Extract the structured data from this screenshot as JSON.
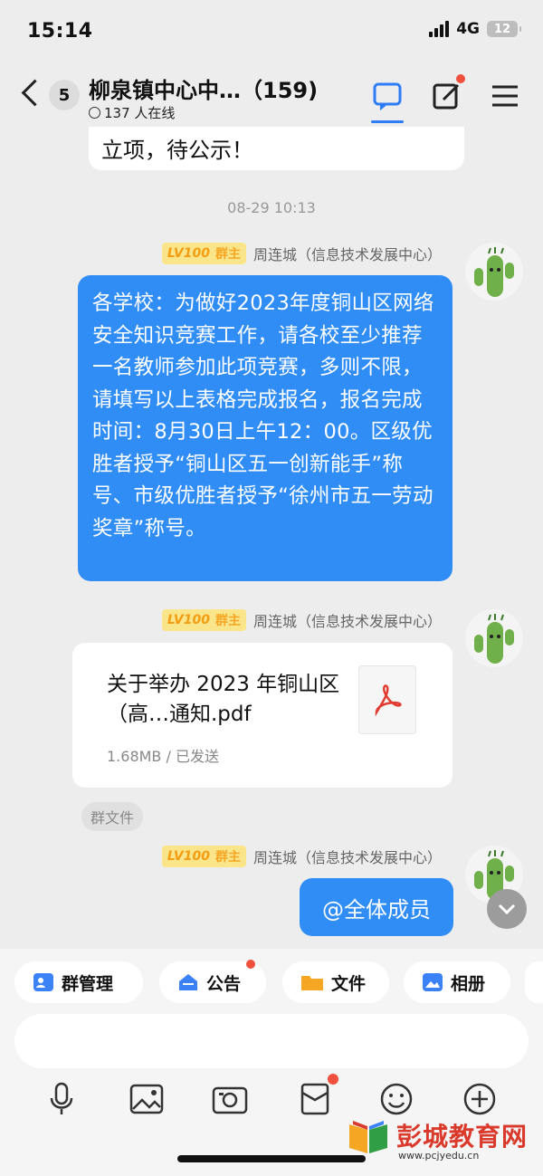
{
  "status_bar": {
    "time": "15:14",
    "network": "4G",
    "battery": "12"
  },
  "header": {
    "unread_count": "5",
    "title": "柳泉镇中心中…（159)",
    "online": "137 人在线"
  },
  "messages": {
    "previous_text": "立项，待公示！",
    "timestamp": "08-29 10:13",
    "sender": {
      "level": "LV100",
      "role": "群主",
      "name": "周连城（信息技术发展中心）"
    },
    "text_message": "各学校：为做好2023年度铜山区网络安全知识竞赛工作，请各校至少推荐一名教师参加此项竞赛，多则不限，请填写以上表格完成报名，报名完成时间：8月30日上午12：00。区级优胜者授予“铜山区五一创新能手”称号、市级优胜者授予“徐州市五一劳动奖章”称号。",
    "file": {
      "name": "关于举办 2023 年铜山区（高…通知.pdf",
      "meta": "1.68MB / 已发送",
      "tag": "群文件"
    },
    "at_all": "@全体成员"
  },
  "quick_actions": [
    {
      "label": "群管理",
      "icon": "group-manage-icon",
      "badge": false
    },
    {
      "label": "公告",
      "icon": "announcement-icon",
      "badge": true
    },
    {
      "label": "文件",
      "icon": "folder-icon",
      "badge": false
    },
    {
      "label": "相册",
      "icon": "album-icon",
      "badge": false
    }
  ],
  "input": {
    "placeholder": ""
  },
  "toolbar": [
    "microphone-icon",
    "image-icon",
    "camera-icon",
    "red-packet-icon",
    "emoji-icon",
    "plus-icon"
  ],
  "watermark": {
    "text": "彭城教育网",
    "url": "www.pcjyedu.cn"
  },
  "colors": {
    "accent": "#2f8df5",
    "badge_red": "#f0503c",
    "background": "#ededed"
  }
}
